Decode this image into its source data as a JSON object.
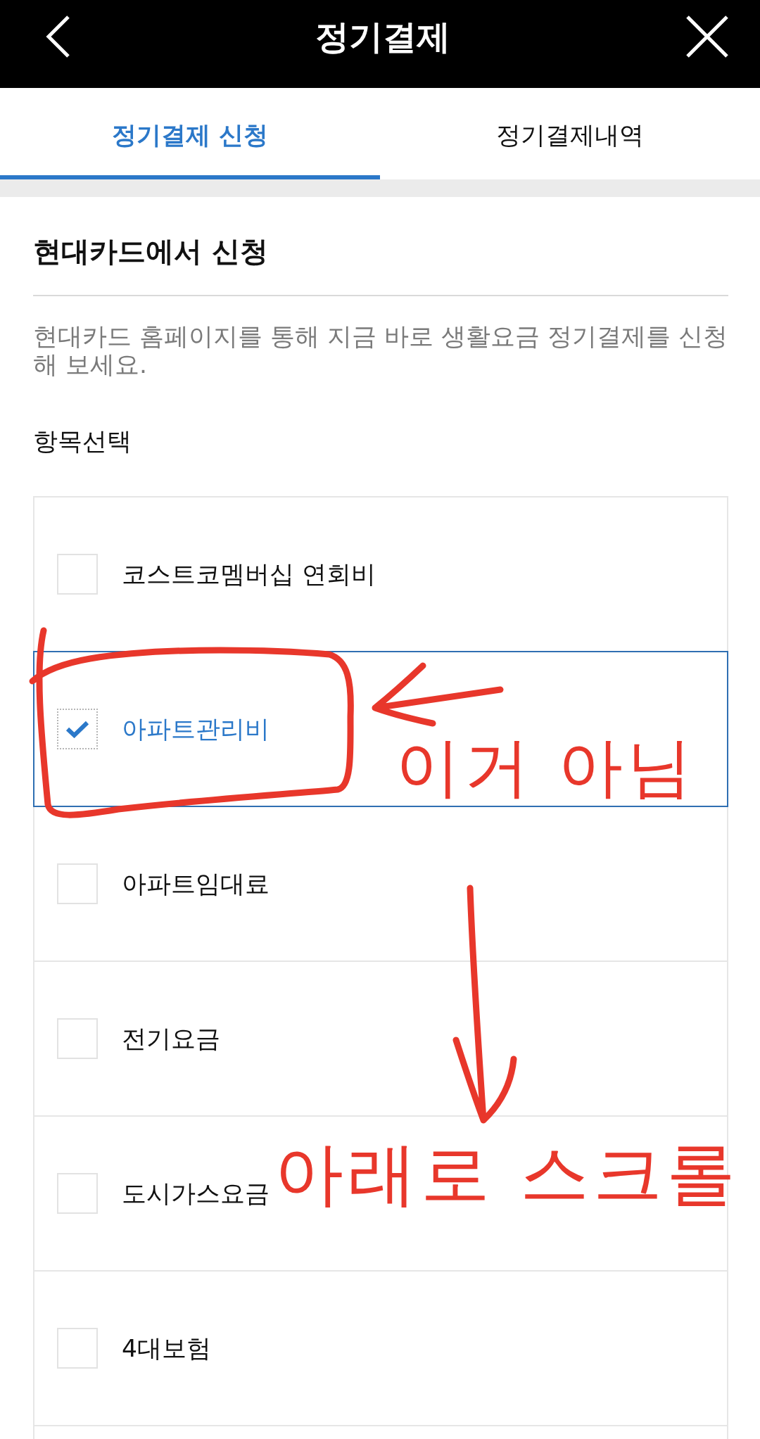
{
  "header": {
    "title": "정기결제"
  },
  "tabs": [
    {
      "label": "정기결제 신청",
      "selected": true
    },
    {
      "label": "정기결제내역",
      "selected": false
    }
  ],
  "section": {
    "title": "현대카드에서 신청",
    "description": "현대카드 홈페이지를 통해 지금 바로 생활요금 정기결제를 신청해 보세요.",
    "list_label": "항목선택"
  },
  "items": [
    {
      "label": "코스트코멤버십 연회비",
      "checked": false
    },
    {
      "label": "아파트관리비",
      "checked": true,
      "note": "이거 아님"
    },
    {
      "label": "아파트임대료",
      "checked": false
    },
    {
      "label": "전기요금",
      "checked": false
    },
    {
      "label": "도시가스요금",
      "checked": false,
      "note": "아래로 스크롤"
    },
    {
      "label": "4대보험",
      "checked": false
    }
  ]
}
